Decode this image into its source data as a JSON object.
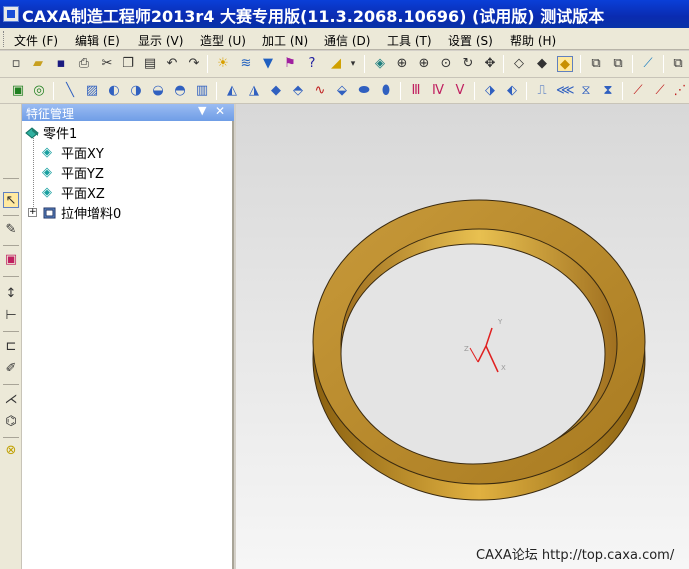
{
  "window": {
    "title": "CAXA制造工程师2013r4 大赛专用版(11.3.2068.10696) (试用版) 测试版本"
  },
  "menu": {
    "items": [
      {
        "label": "文件 (F)"
      },
      {
        "label": "编辑 (E)"
      },
      {
        "label": "显示 (V)"
      },
      {
        "label": "造型 (U)"
      },
      {
        "label": "加工 (N)"
      },
      {
        "label": "通信 (D)"
      },
      {
        "label": "工具 (T)"
      },
      {
        "label": "设置 (S)"
      },
      {
        "label": "帮助 (H)"
      }
    ]
  },
  "feature_tree": {
    "title": "特征管理",
    "part": "零件1",
    "planes": [
      "平面XY",
      "平面YZ",
      "平面XZ"
    ],
    "features": [
      "拉伸增料0"
    ]
  },
  "viewport": {
    "watermark": "CAXA论坛 http://top.caxa.com/",
    "ring_color": "#b8862a",
    "background": "#e6e6e6"
  },
  "toolbar1_icons": [
    "new-file-icon",
    "open-file-icon",
    "save-icon",
    "print-icon",
    "cut-icon",
    "copy-icon",
    "paste-icon",
    "undo-icon",
    "redo-icon",
    "light-icon",
    "curve-icon",
    "filter-icon",
    "query-icon",
    "help-icon",
    "layer-icon",
    "render-icon",
    "zoom-window-icon",
    "zoom-in-icon",
    "zoom-dynamic-icon",
    "rotate-icon",
    "pan-icon",
    "wireframe-icon",
    "hidden-line-icon",
    "shaded-icon",
    "copy-view-icon",
    "paste-view-icon",
    "extrude-tool-icon",
    "new-view-icon"
  ],
  "toolbar2_icons": [
    "point-icon",
    "line-icon",
    "surface-icon",
    "revolve-icon",
    "sweep-icon",
    "loft-icon",
    "blend-icon",
    "fillet-icon",
    "shell-icon",
    "draft-icon",
    "hole-icon",
    "rib-icon",
    "mirror-icon",
    "array-icon",
    "boolean-icon",
    "split-icon",
    "trim-icon",
    "offset-icon",
    "chamfer-icon",
    "pattern-icon",
    "scale-icon",
    "measure-icon",
    "import-icon",
    "export-icon",
    "check-icon",
    "tolerance-icon",
    "clear-icon",
    "extend-icon"
  ],
  "left_toolbar_icons": [
    "select-arrow-icon",
    "sketch-icon",
    "color-icon",
    "dimension-icon",
    "constraint-icon",
    "transform-icon",
    "trim-sketch-icon",
    "project-icon",
    "section-icon",
    "view-icon"
  ]
}
